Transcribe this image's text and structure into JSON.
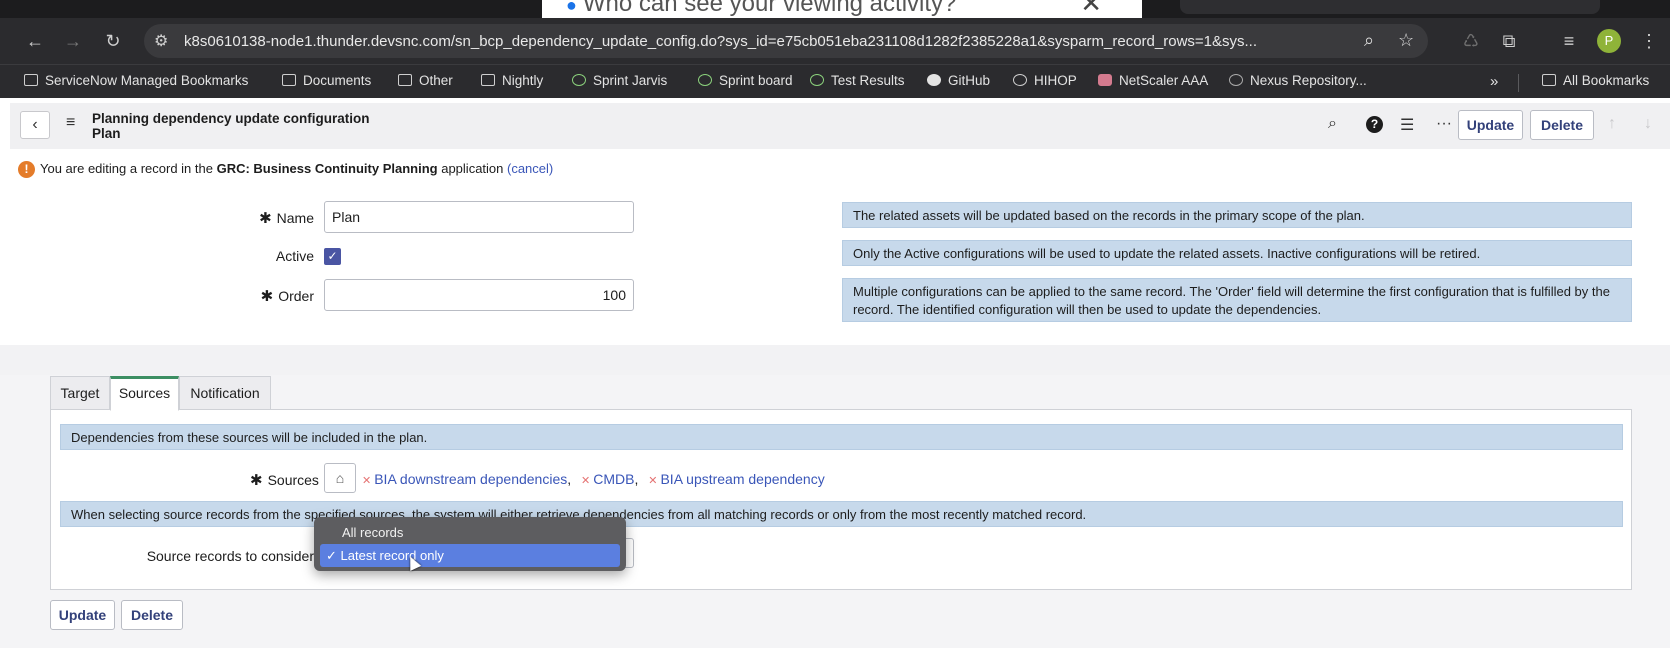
{
  "browser": {
    "popup_tab_text": "Who can see your viewing activity?",
    "url": "k8s0610138-node1.thunder.devsnc.com/sn_bcp_dependency_update_config.do?sys_id=e75cb051eba231108d1282f2385228a1&sysparm_record_rows=1&sys...",
    "profile_initial": "P",
    "bookmarks": [
      {
        "label": "ServiceNow Managed Bookmarks",
        "icon": "managed-folder-icon"
      },
      {
        "label": "Documents",
        "icon": "folder-icon"
      },
      {
        "label": "Other",
        "icon": "folder-icon"
      },
      {
        "label": "Nightly",
        "icon": "folder-icon"
      },
      {
        "label": "Sprint Jarvis",
        "icon": "site-icon"
      },
      {
        "label": "Sprint board",
        "icon": "site-icon"
      },
      {
        "label": "Test Results",
        "icon": "site-icon"
      },
      {
        "label": "GitHub",
        "icon": "github-icon"
      },
      {
        "label": "HIHOP",
        "icon": "globe-icon"
      },
      {
        "label": "NetScaler AAA",
        "icon": "lock-icon"
      },
      {
        "label": "Nexus Repository...",
        "icon": "site-icon"
      }
    ],
    "overflow_label": "»",
    "all_bookmarks_label": "All Bookmarks"
  },
  "header": {
    "title_line1": "Planning dependency update configuration",
    "title_line2": "Plan",
    "update_label": "Update",
    "delete_label": "Delete"
  },
  "notice": {
    "prefix": "You are editing a record in the ",
    "app_name": "GRC: Business Continuity Planning",
    "suffix": " application ",
    "cancel_link": "(cancel)"
  },
  "form": {
    "name_label": "Name",
    "name_value": "Plan",
    "active_label": "Active",
    "active_checked": true,
    "order_label": "Order",
    "order_value": "100",
    "hint_name": "The related assets will be updated based on the records in the primary scope of the plan.",
    "hint_active": "Only the Active configurations will be used to update the related assets. Inactive configurations will be retired.",
    "hint_order": "Multiple configurations can be applied to the same record. The 'Order' field will determine the first configuration that is fulfilled by the record. The identified configuration will then be used to update the dependencies."
  },
  "tabs": [
    {
      "label": "Target",
      "active": false
    },
    {
      "label": "Sources",
      "active": true
    },
    {
      "label": "Notification",
      "active": false
    }
  ],
  "sources_tab": {
    "info": "Dependencies from these sources will be included in the plan.",
    "sources_label": "Sources",
    "sources": [
      "BIA downstream dependencies",
      "CMDB",
      "BIA upstream dependency"
    ],
    "selection_info": "When selecting source records from the specified sources, the system will either retrieve dependencies from all matching records or only from the most recently matched record.",
    "consider_label": "Source records to consider",
    "options": [
      "All records",
      "Latest record only"
    ],
    "selected_option": "Latest record only"
  },
  "footer": {
    "update_label": "Update",
    "delete_label": "Delete"
  },
  "colors": {
    "accent": "#33417a",
    "hint_bg": "#c7d9eb",
    "active_tab": "#3d8f63",
    "warning": "#e47c2a"
  }
}
